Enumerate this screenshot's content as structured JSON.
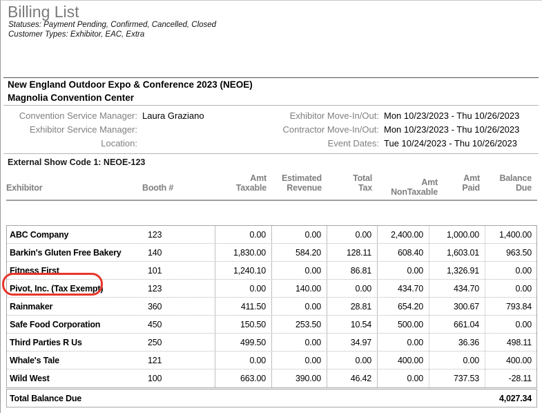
{
  "report": {
    "title": "Billing List",
    "statuses_line": "Statuses: Payment Pending, Confirmed, Cancelled, Closed",
    "customer_types_line": "Customer Types: Exhibitor, EAC, Extra"
  },
  "event": {
    "name": "New England Outdoor Expo & Conference 2023 (NEOE)",
    "venue": "Magnolia Convention Center",
    "info_rows": [
      {
        "label1": "Convention Service Manager:",
        "value1": "Laura Graziano",
        "label2": "Exhibitor Move-In/Out:",
        "value2": "Mon 10/23/2023 - Thu 10/26/2023"
      },
      {
        "label1": "Exhibitor Service Manager:",
        "value1": "",
        "label2": "Contractor Move-In/Out:",
        "value2": "Mon 10/23/2023 - Thu 10/26/2023"
      },
      {
        "label1": "Location:",
        "value1": "",
        "label2": "Event Dates:",
        "value2": "Tue 10/24/2023 - Thu 10/26/2023"
      }
    ],
    "external_show_code": "External Show Code 1: NEOE-123"
  },
  "table": {
    "headers": [
      {
        "l1": "",
        "l2": "Exhibitor"
      },
      {
        "l1": "",
        "l2": "Booth #"
      },
      {
        "l1": "Amt",
        "l2": "Taxable"
      },
      {
        "l1": "Estimated",
        "l2": "Revenue"
      },
      {
        "l1": "Total",
        "l2": "Tax"
      },
      {
        "l1": "Amt",
        "l2": "NonTaxable"
      },
      {
        "l1": "Amt",
        "l2": "Paid"
      },
      {
        "l1": "Balance",
        "l2": "Due"
      }
    ],
    "fields": [
      "exhibitor",
      "booth",
      "amt_taxable",
      "estimated_revenue",
      "total_tax",
      "amt_nontaxable",
      "amt_paid",
      "balance_due"
    ],
    "rows": [
      {
        "exhibitor": "ABC Company",
        "booth": "123",
        "amt_taxable": "0.00",
        "estimated_revenue": "0.00",
        "total_tax": "0.00",
        "amt_nontaxable": "2,400.00",
        "amt_paid": "1,000.00",
        "balance_due": "1,400.00"
      },
      {
        "exhibitor": "Barkin's Gluten Free Bakery",
        "booth": "140",
        "amt_taxable": "1,830.00",
        "estimated_revenue": "584.20",
        "total_tax": "128.11",
        "amt_nontaxable": "608.40",
        "amt_paid": "1,603.01",
        "balance_due": "963.50"
      },
      {
        "exhibitor": "Fitness First",
        "booth": "101",
        "amt_taxable": "1,240.10",
        "estimated_revenue": "0.00",
        "total_tax": "86.81",
        "amt_nontaxable": "0.00",
        "amt_paid": "1,326.91",
        "balance_due": "0.00"
      },
      {
        "exhibitor": "Pivot, Inc. (Tax Exempt)",
        "booth": "123",
        "amt_taxable": "0.00",
        "estimated_revenue": "140.00",
        "total_tax": "0.00",
        "amt_nontaxable": "434.70",
        "amt_paid": "434.70",
        "balance_due": "0.00"
      },
      {
        "exhibitor": "Rainmaker",
        "booth": "360",
        "amt_taxable": "411.50",
        "estimated_revenue": "0.00",
        "total_tax": "28.81",
        "amt_nontaxable": "654.20",
        "amt_paid": "300.67",
        "balance_due": "793.84"
      },
      {
        "exhibitor": "Safe Food Corporation",
        "booth": "450",
        "amt_taxable": "150.50",
        "estimated_revenue": "253.50",
        "total_tax": "10.54",
        "amt_nontaxable": "500.00",
        "amt_paid": "661.04",
        "balance_due": "0.00"
      },
      {
        "exhibitor": "Third Parties R Us",
        "booth": "250",
        "amt_taxable": "499.50",
        "estimated_revenue": "0.00",
        "total_tax": "34.97",
        "amt_nontaxable": "0.00",
        "amt_paid": "36.36",
        "balance_due": "498.11"
      },
      {
        "exhibitor": "Whale's Tale",
        "booth": "121",
        "amt_taxable": "0.00",
        "estimated_revenue": "0.00",
        "total_tax": "0.00",
        "amt_nontaxable": "400.00",
        "amt_paid": "0.00",
        "balance_due": "400.00"
      },
      {
        "exhibitor": "Wild West",
        "booth": "100",
        "amt_taxable": "663.00",
        "estimated_revenue": "390.00",
        "total_tax": "46.42",
        "amt_nontaxable": "0.00",
        "amt_paid": "737.53",
        "balance_due": "-28.11"
      }
    ],
    "total_label": "Total Balance Due",
    "total_value": "4,027.34"
  },
  "annotation": {
    "shape": "rounded-ellipse",
    "color": "#e8352b",
    "circled_row": "Pivot, Inc. (Tax Exempt)"
  }
}
